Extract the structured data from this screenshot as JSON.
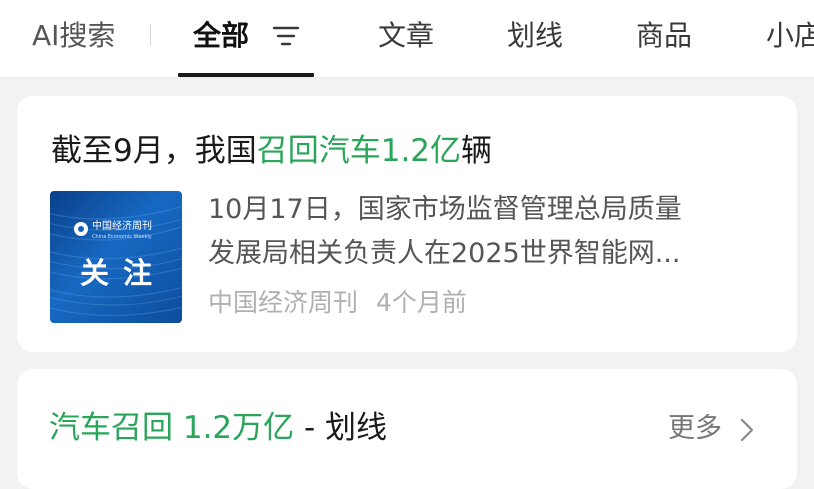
{
  "tabs": {
    "ai_search": "AI搜索",
    "all": "全部",
    "article": "文章",
    "highlight": "划线",
    "product": "商品",
    "shop": "小店"
  },
  "icons": {
    "filter": "filter-icon",
    "chevron": "chevron-right-icon"
  },
  "colors": {
    "highlight_green": "#2aa55a",
    "active_tab_underline": "#1a1a1a",
    "page_background": "#f2f2f2"
  },
  "article": {
    "title_prefix": "截至9月，我国",
    "title_highlight": "召回汽车1.2亿",
    "title_suffix": "辆",
    "thumbnail": {
      "brand": "中国经济周刊",
      "brand_en": "China Economic Weekly",
      "word": "关注"
    },
    "summary_line1": "10月17日，国家市场监督管理总局质量",
    "summary_line2": "发展局相关负责人在2025世界智能网...",
    "source": "中国经济周刊",
    "time": "4个月前"
  },
  "highlights_section": {
    "title_highlight": "汽车召回 1.2万亿",
    "title_suffix": " - 划线",
    "more_label": "更多"
  }
}
